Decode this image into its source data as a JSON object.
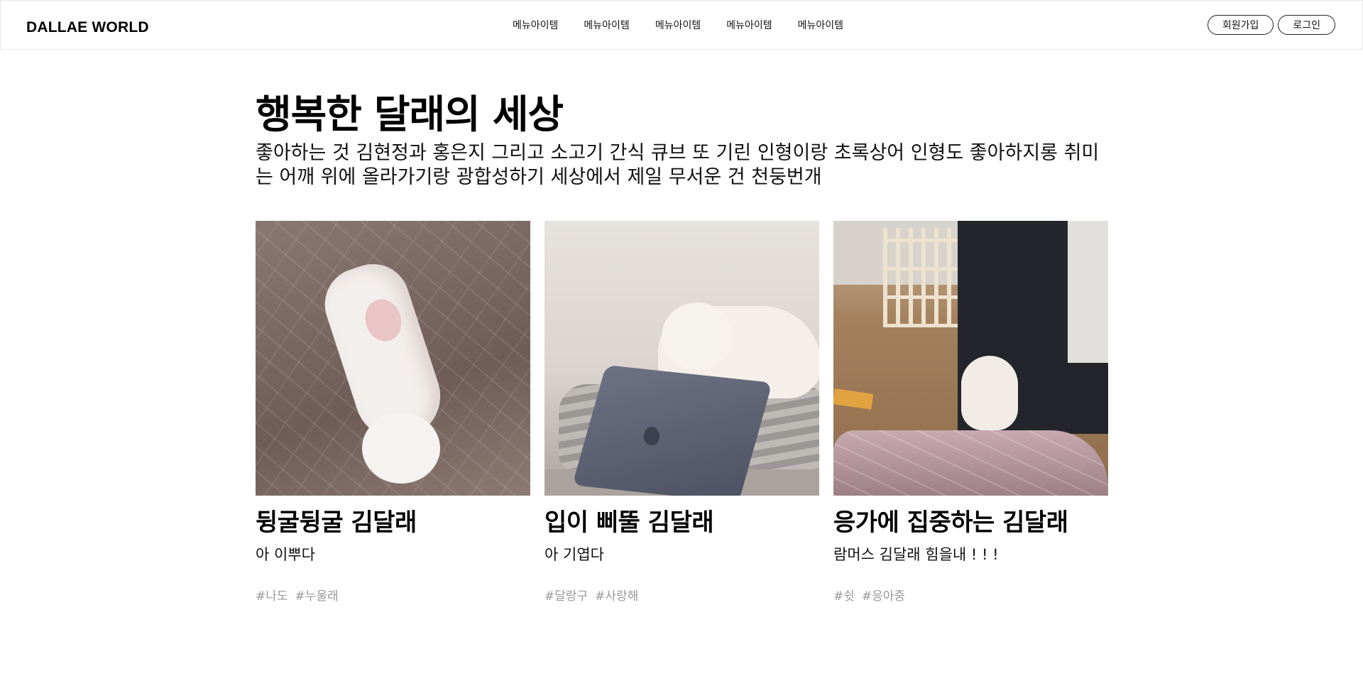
{
  "header": {
    "logo": "DALLAE WORLD",
    "nav": [
      "메뉴아이템",
      "메뉴아이템",
      "메뉴아이템",
      "메뉴아이템",
      "메뉴아이템"
    ],
    "signup_label": "회원가입",
    "login_label": "로그인"
  },
  "main": {
    "title": "행복한 달래의 세상",
    "intro": "좋아하는 것 김현정과 홍은지 그리고 소고기 간식 큐브 또 기린 인형이랑 초록상어 인형도 좋아하지롱 취미는 어깨 위에 올라가기랑 광합성하기 세상에서 제일 무서운 건 천둥번개",
    "cards": [
      {
        "title": "뒹굴뒹굴 김달래",
        "desc": "아 이뿌다",
        "tags": [
          "#나도",
          "#누울래"
        ]
      },
      {
        "title": "입이 삐뚤 김달래",
        "desc": "아 기엽다",
        "tags": [
          "#달랑구",
          "#사랑해"
        ]
      },
      {
        "title": "응가에 집중하는 김달래",
        "desc": "람머스 김달래 힘을내 ! ! !",
        "tags": [
          "#쉿",
          "#응아중"
        ]
      }
    ]
  }
}
